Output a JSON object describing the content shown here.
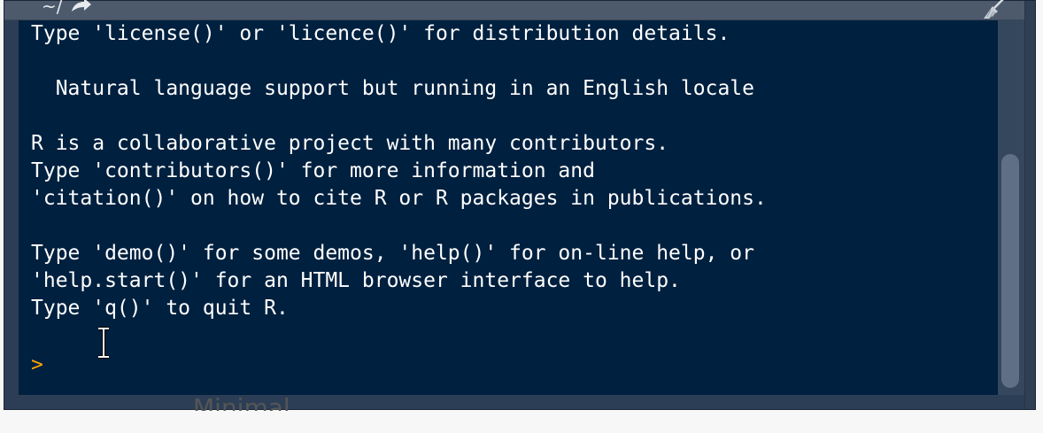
{
  "header": {
    "path": "~/",
    "icons": [
      "go-to-directory-icon",
      "broom-icon"
    ]
  },
  "console": {
    "output_lines": [
      "Type 'license()' or 'licence()' for distribution details.",
      "",
      "  Natural language support but running in an English locale",
      "",
      "R is a collaborative project with many contributors.",
      "Type 'contributors()' for more information and",
      "'citation()' on how to cite R or R packages in publications.",
      "",
      "Type 'demo()' for some demos, 'help()' for on-line help, or",
      "'help.start()' for an HTML browser interface to help.",
      "Type 'q()' to quit R."
    ],
    "prompt": ">",
    "input_value": "",
    "prompt_color": "#ffa500",
    "background_color": "#00203f",
    "text_color": "#ffffff"
  },
  "below": {
    "text": "Minimal"
  }
}
